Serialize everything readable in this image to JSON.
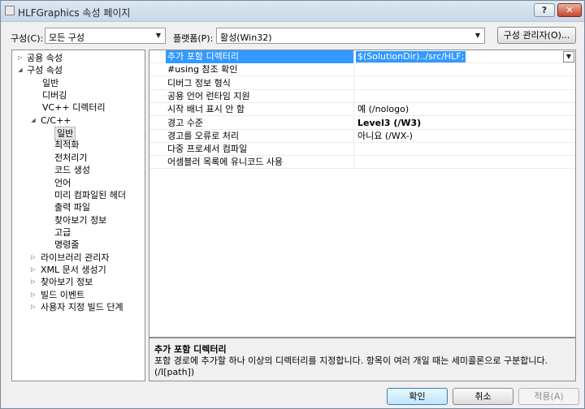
{
  "window": {
    "title": "HLFGraphics 속성 페이지",
    "help_label": "?",
    "close_label": "✕"
  },
  "toolbar": {
    "config_label": "구성(C):",
    "config_value": "모든 구성",
    "platform_label": "플랫폼(P):",
    "platform_value": "활성(Win32)",
    "config_manager_label": "구성 관리자(O)..."
  },
  "tree": {
    "items": [
      {
        "label": "공용 속성",
        "expander": "▷"
      },
      {
        "label": "구성 속성",
        "expander": "◢"
      },
      {
        "label": "일반",
        "expander": ""
      },
      {
        "label": "디버깅",
        "expander": ""
      },
      {
        "label": "VC++ 디렉터리",
        "expander": ""
      },
      {
        "label": "C/C++",
        "expander": "◢"
      },
      {
        "label": "일반",
        "expander": ""
      },
      {
        "label": "최적화",
        "expander": ""
      },
      {
        "label": "전처리기",
        "expander": ""
      },
      {
        "label": "코드 생성",
        "expander": ""
      },
      {
        "label": "언어",
        "expander": ""
      },
      {
        "label": "미리 컴파일된 헤더",
        "expander": ""
      },
      {
        "label": "출력 파일",
        "expander": ""
      },
      {
        "label": "찾아보기 정보",
        "expander": ""
      },
      {
        "label": "고급",
        "expander": ""
      },
      {
        "label": "명령줄",
        "expander": ""
      },
      {
        "label": "라이브러리 관리자",
        "expander": "▷"
      },
      {
        "label": "XML 문서 생성기",
        "expander": "▷"
      },
      {
        "label": "찾아보기 정보",
        "expander": "▷"
      },
      {
        "label": "빌드 이벤트",
        "expander": "▷"
      },
      {
        "label": "사용자 지정 빌드 단계",
        "expander": "▷"
      }
    ],
    "selected_index": 6
  },
  "grid": {
    "rows": [
      {
        "name": "추가 포함 디렉터리",
        "value": "$(SolutionDir)../src/HLF;"
      },
      {
        "name": "#using 참조 확인",
        "value": ""
      },
      {
        "name": "디버그 정보 형식",
        "value": ""
      },
      {
        "name": "공용 언어 런타임 지원",
        "value": ""
      },
      {
        "name": "시작 배너 표시 안 함",
        "value": "예 (/nologo)"
      },
      {
        "name": "경고 수준",
        "value": "Level3 (/W3)"
      },
      {
        "name": "경고를 오류로 처리",
        "value": "아니요 (/WX-)"
      },
      {
        "name": "다중 프로세서 컴파일",
        "value": ""
      },
      {
        "name": "어셈블러 목록에 유니코드 사용",
        "value": ""
      }
    ],
    "selected_index": 0,
    "bold_index": 5
  },
  "description": {
    "title": "추가 포함 디렉터리",
    "text": "포함 경로에 추가할 하나 이상의 디렉터리를 지정합니다. 항목이 여러 개일 때는 세미콜론으로 구분합니다. (/I[path])"
  },
  "buttons": {
    "ok_label": "확인",
    "cancel_label": "취소",
    "apply_label": "적용(A)"
  },
  "icons": {
    "dropdown_icon": "▼"
  }
}
